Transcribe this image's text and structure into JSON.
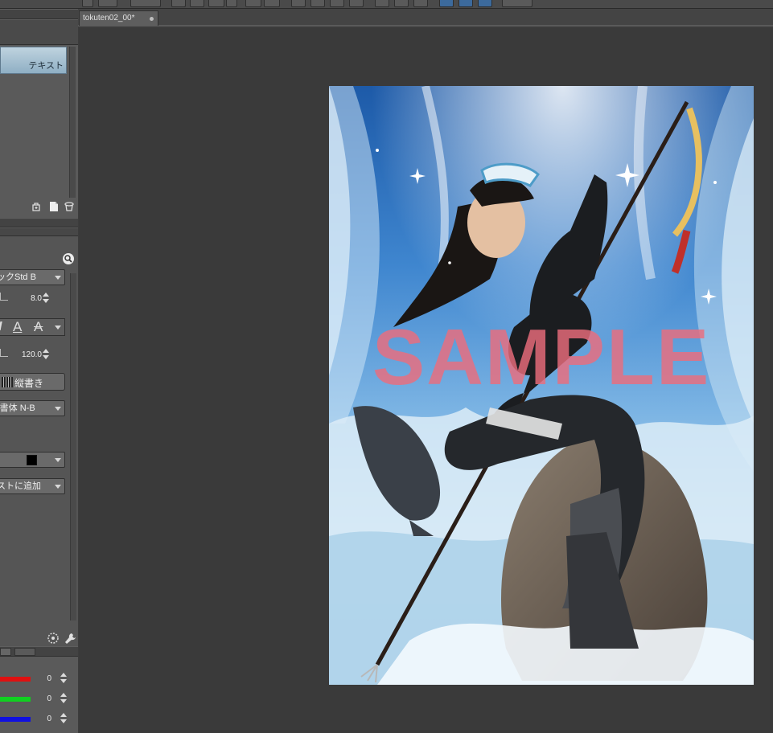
{
  "document": {
    "tab_title": "tokuten02_00*"
  },
  "layer_panel": {
    "tab_label": "テキスト"
  },
  "text_tool": {
    "font_name": "ックStd B",
    "size_value": "8.0",
    "line_spacing_value": "120.0",
    "direction_label": "縦書き",
    "font2_name": "-書体 N-B",
    "add_label": "ストに追加"
  },
  "color_panel": {
    "red_value": "0",
    "green_value": "0",
    "blue_value": "0"
  },
  "artwork": {
    "watermark": "SAMPLE"
  },
  "colors": {
    "panel_bg": "#575757",
    "canvas_bg": "#3a3a3a",
    "accent_tab": "#a8c4d6",
    "watermark": "#ec6c7c"
  },
  "icons": [
    "new-layer-icon",
    "page-icon",
    "trash-icon",
    "search-icon",
    "settings-icon",
    "wrench-icon"
  ]
}
